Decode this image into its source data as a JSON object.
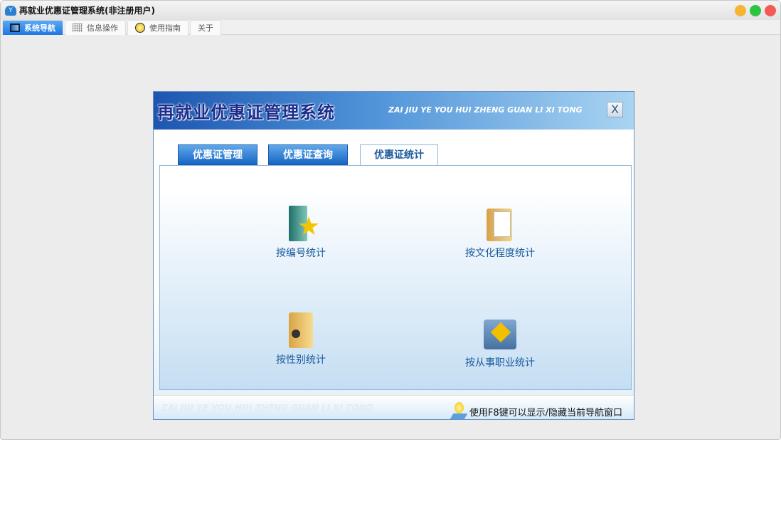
{
  "window": {
    "title": "再就业优惠证管理系统(非注册用户)",
    "controls": {
      "minimize": "#f5b532",
      "maximize": "#2cc442",
      "close": "#f45a53"
    }
  },
  "tabs": [
    {
      "label": "系统导航",
      "icon": "monitor-icon",
      "active": true
    },
    {
      "label": "信息操作",
      "icon": "grid-icon"
    },
    {
      "label": "使用指南",
      "icon": "help-icon"
    },
    {
      "label": "关于"
    }
  ],
  "panel": {
    "title": "再就业优惠证管理系统",
    "subtitle": "ZAI JIU YE YOU HUI ZHENG GUAN LI XI TONG",
    "close_label": "X",
    "tabs": [
      {
        "label": "优惠证管理"
      },
      {
        "label": "优惠证查询"
      },
      {
        "label": "优惠证统计",
        "active": true
      }
    ],
    "items": [
      {
        "label": "按编号统计",
        "icon": "star-book-icon"
      },
      {
        "label": "按文化程度统计",
        "icon": "folder-documents-icon"
      },
      {
        "label": "按性别统计",
        "icon": "folder-door-icon"
      },
      {
        "label": "按从事职业统计",
        "icon": "folder-pedestrian-icon"
      }
    ],
    "footer": {
      "watermark": "ZAI JIU YE YOU HUI ZHENG GUAN LI XI TONG",
      "hint": "使用F8键可以显示/隐藏当前导航窗口"
    }
  }
}
